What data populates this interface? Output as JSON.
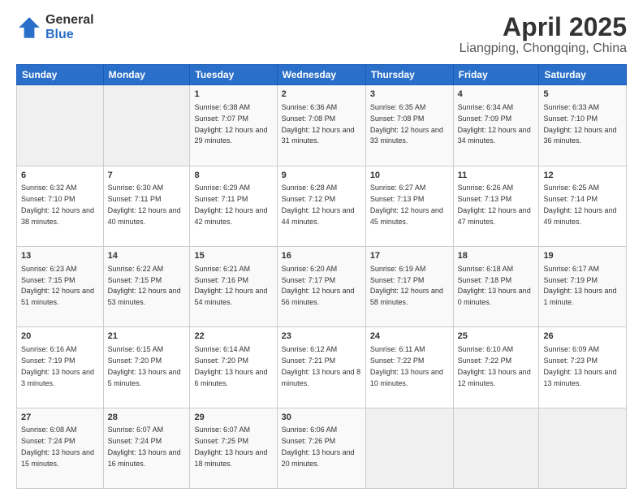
{
  "header": {
    "logo_general": "General",
    "logo_blue": "Blue",
    "main_title": "April 2025",
    "subtitle": "Liangping, Chongqing, China"
  },
  "weekdays": [
    "Sunday",
    "Monday",
    "Tuesday",
    "Wednesday",
    "Thursday",
    "Friday",
    "Saturday"
  ],
  "weeks": [
    [
      {
        "day": "",
        "info": ""
      },
      {
        "day": "",
        "info": ""
      },
      {
        "day": "1",
        "info": "Sunrise: 6:38 AM\nSunset: 7:07 PM\nDaylight: 12 hours and 29 minutes."
      },
      {
        "day": "2",
        "info": "Sunrise: 6:36 AM\nSunset: 7:08 PM\nDaylight: 12 hours and 31 minutes."
      },
      {
        "day": "3",
        "info": "Sunrise: 6:35 AM\nSunset: 7:08 PM\nDaylight: 12 hours and 33 minutes."
      },
      {
        "day": "4",
        "info": "Sunrise: 6:34 AM\nSunset: 7:09 PM\nDaylight: 12 hours and 34 minutes."
      },
      {
        "day": "5",
        "info": "Sunrise: 6:33 AM\nSunset: 7:10 PM\nDaylight: 12 hours and 36 minutes."
      }
    ],
    [
      {
        "day": "6",
        "info": "Sunrise: 6:32 AM\nSunset: 7:10 PM\nDaylight: 12 hours and 38 minutes."
      },
      {
        "day": "7",
        "info": "Sunrise: 6:30 AM\nSunset: 7:11 PM\nDaylight: 12 hours and 40 minutes."
      },
      {
        "day": "8",
        "info": "Sunrise: 6:29 AM\nSunset: 7:11 PM\nDaylight: 12 hours and 42 minutes."
      },
      {
        "day": "9",
        "info": "Sunrise: 6:28 AM\nSunset: 7:12 PM\nDaylight: 12 hours and 44 minutes."
      },
      {
        "day": "10",
        "info": "Sunrise: 6:27 AM\nSunset: 7:13 PM\nDaylight: 12 hours and 45 minutes."
      },
      {
        "day": "11",
        "info": "Sunrise: 6:26 AM\nSunset: 7:13 PM\nDaylight: 12 hours and 47 minutes."
      },
      {
        "day": "12",
        "info": "Sunrise: 6:25 AM\nSunset: 7:14 PM\nDaylight: 12 hours and 49 minutes."
      }
    ],
    [
      {
        "day": "13",
        "info": "Sunrise: 6:23 AM\nSunset: 7:15 PM\nDaylight: 12 hours and 51 minutes."
      },
      {
        "day": "14",
        "info": "Sunrise: 6:22 AM\nSunset: 7:15 PM\nDaylight: 12 hours and 53 minutes."
      },
      {
        "day": "15",
        "info": "Sunrise: 6:21 AM\nSunset: 7:16 PM\nDaylight: 12 hours and 54 minutes."
      },
      {
        "day": "16",
        "info": "Sunrise: 6:20 AM\nSunset: 7:17 PM\nDaylight: 12 hours and 56 minutes."
      },
      {
        "day": "17",
        "info": "Sunrise: 6:19 AM\nSunset: 7:17 PM\nDaylight: 12 hours and 58 minutes."
      },
      {
        "day": "18",
        "info": "Sunrise: 6:18 AM\nSunset: 7:18 PM\nDaylight: 13 hours and 0 minutes."
      },
      {
        "day": "19",
        "info": "Sunrise: 6:17 AM\nSunset: 7:19 PM\nDaylight: 13 hours and 1 minute."
      }
    ],
    [
      {
        "day": "20",
        "info": "Sunrise: 6:16 AM\nSunset: 7:19 PM\nDaylight: 13 hours and 3 minutes."
      },
      {
        "day": "21",
        "info": "Sunrise: 6:15 AM\nSunset: 7:20 PM\nDaylight: 13 hours and 5 minutes."
      },
      {
        "day": "22",
        "info": "Sunrise: 6:14 AM\nSunset: 7:20 PM\nDaylight: 13 hours and 6 minutes."
      },
      {
        "day": "23",
        "info": "Sunrise: 6:12 AM\nSunset: 7:21 PM\nDaylight: 13 hours and 8 minutes."
      },
      {
        "day": "24",
        "info": "Sunrise: 6:11 AM\nSunset: 7:22 PM\nDaylight: 13 hours and 10 minutes."
      },
      {
        "day": "25",
        "info": "Sunrise: 6:10 AM\nSunset: 7:22 PM\nDaylight: 13 hours and 12 minutes."
      },
      {
        "day": "26",
        "info": "Sunrise: 6:09 AM\nSunset: 7:23 PM\nDaylight: 13 hours and 13 minutes."
      }
    ],
    [
      {
        "day": "27",
        "info": "Sunrise: 6:08 AM\nSunset: 7:24 PM\nDaylight: 13 hours and 15 minutes."
      },
      {
        "day": "28",
        "info": "Sunrise: 6:07 AM\nSunset: 7:24 PM\nDaylight: 13 hours and 16 minutes."
      },
      {
        "day": "29",
        "info": "Sunrise: 6:07 AM\nSunset: 7:25 PM\nDaylight: 13 hours and 18 minutes."
      },
      {
        "day": "30",
        "info": "Sunrise: 6:06 AM\nSunset: 7:26 PM\nDaylight: 13 hours and 20 minutes."
      },
      {
        "day": "",
        "info": ""
      },
      {
        "day": "",
        "info": ""
      },
      {
        "day": "",
        "info": ""
      }
    ]
  ]
}
